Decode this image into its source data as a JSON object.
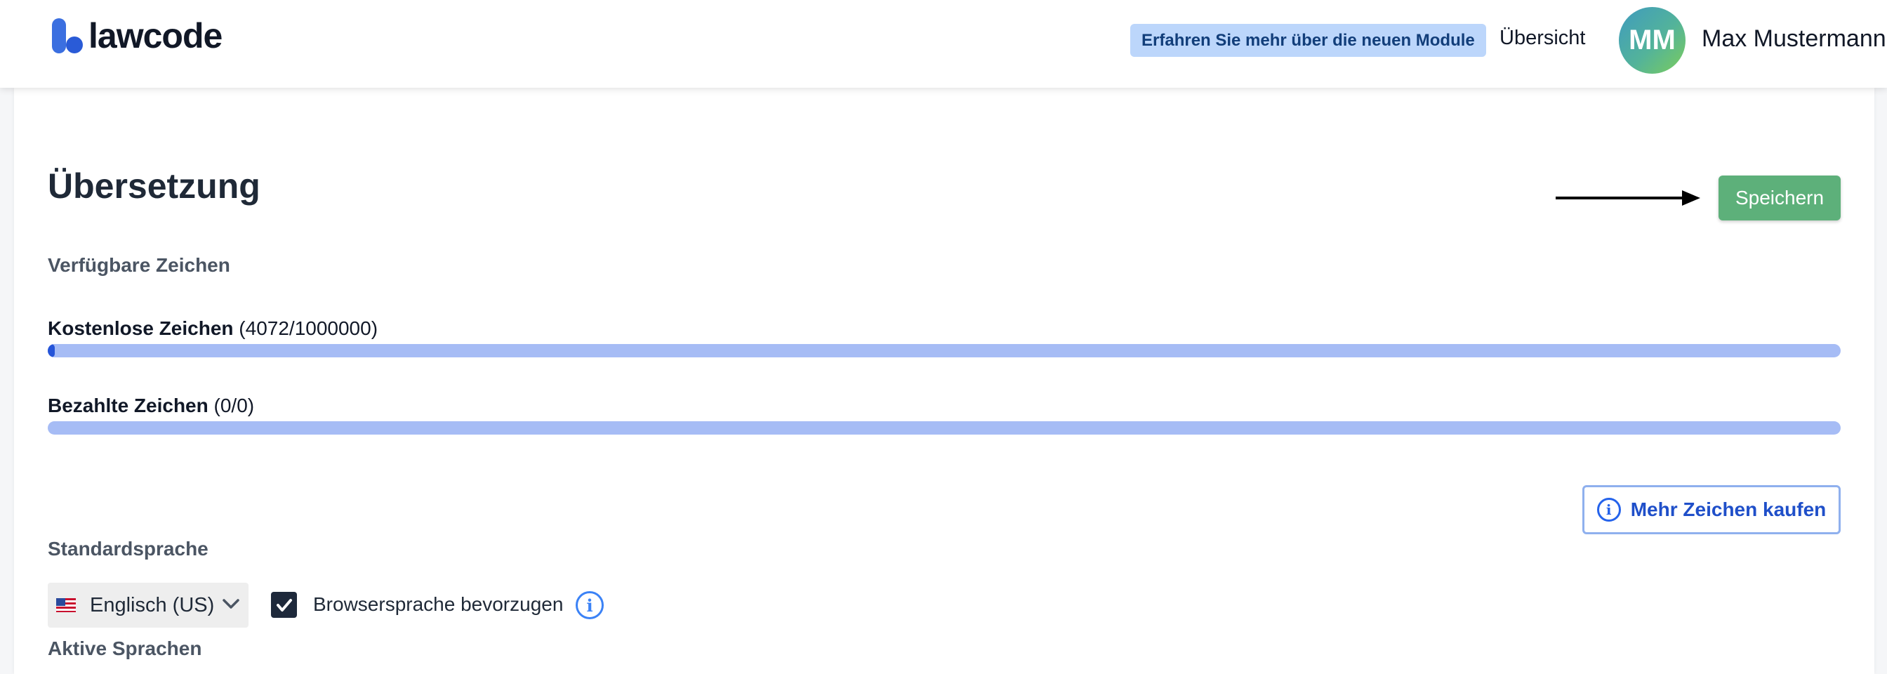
{
  "header": {
    "logo_text": "lawcode",
    "promo_label": "Erfahren Sie mehr über die neuen Module",
    "nav_overview": "Übersicht",
    "avatar_initials": "MM",
    "user_name": "Max Mustermann"
  },
  "page": {
    "title": "Übersetzung",
    "save_label": "Speichern",
    "available_chars_label": "Verfügbare Zeichen"
  },
  "usage": {
    "free": {
      "label": "Kostenlose Zeichen",
      "count_text": "(4072/1000000)",
      "used": 4072,
      "total": 1000000
    },
    "paid": {
      "label": "Bezahlte Zeichen",
      "count_text": "(0/0)",
      "used": 0,
      "total": 0
    }
  },
  "buy_more_label": "Mehr Zeichen kaufen",
  "language": {
    "default_label": "Standardsprache",
    "selected": "Englisch (US)",
    "prefer_browser_label": "Browsersprache bevorzugen",
    "prefer_browser_checked": true,
    "active_label": "Aktive Sprachen"
  },
  "colors": {
    "accent_blue": "#2554d8",
    "save_green": "#5db07a",
    "progress_track": "#a6bcf5"
  },
  "icons": {
    "logo": "lawcode-logo-icon",
    "arrow": "arrow-right-icon",
    "info": "info-icon",
    "flag": "us-flag-icon",
    "chevron": "chevron-down-icon",
    "check": "checkmark-icon"
  }
}
